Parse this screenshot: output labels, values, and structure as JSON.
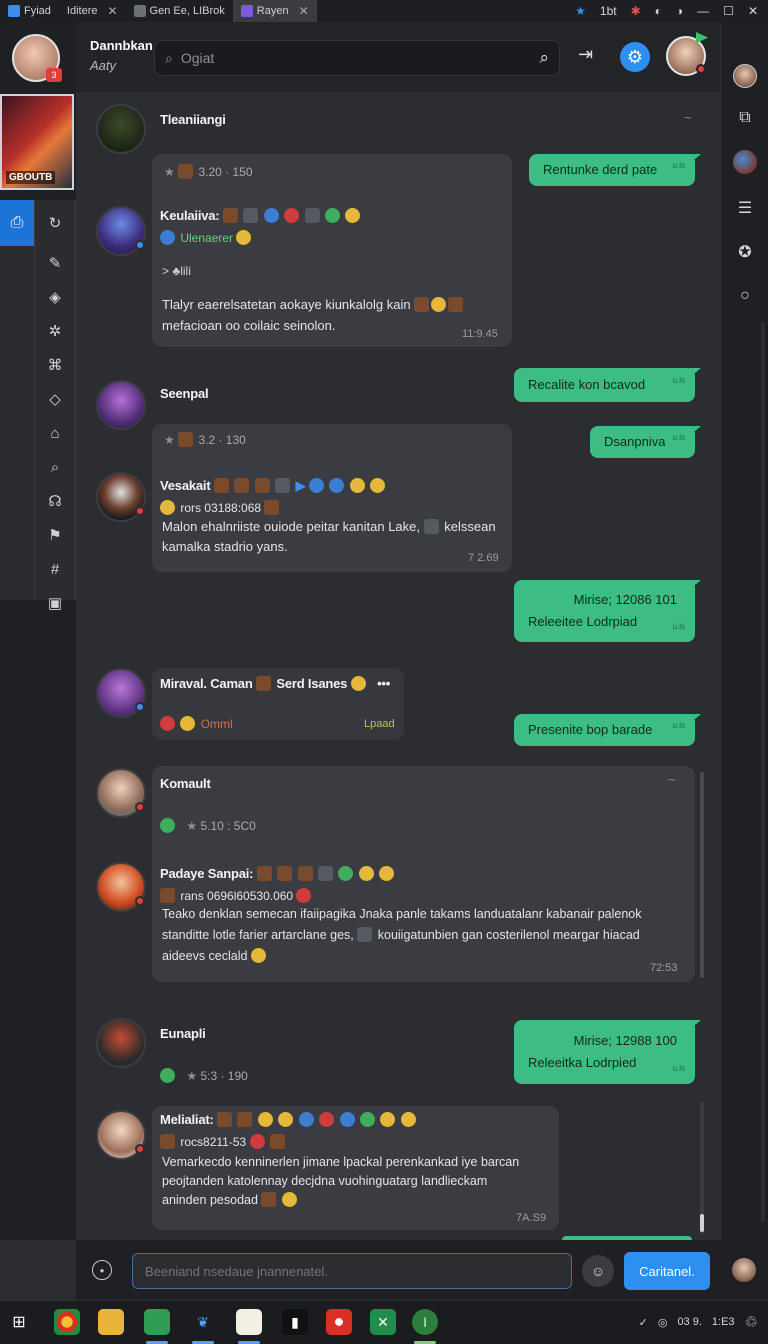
{
  "titlebar": {
    "tabs": [
      {
        "label": "Fyiad"
      },
      {
        "label": "Iditere"
      },
      {
        "label": "Gen Ee, LIBrok"
      },
      {
        "label": "Rayen"
      }
    ],
    "right_label": "1bt"
  },
  "user": {
    "badge": "3"
  },
  "guild": {
    "label": "GBOUTB"
  },
  "header": {
    "name": "Dannbkan",
    "status": "Aaty",
    "search_placeholder": "Ogiat"
  },
  "messages": {
    "m1": {
      "name": "Tleaniiangi",
      "meta": "3.20 · 150"
    },
    "m2": {
      "name": "Keulaiiva:",
      "sub": "Ulenaerer",
      "line": "> ♣lili",
      "text": "Tlalyr eaerelsatetan aokaye kiunkalolg kain",
      "text2": "mefacioan oo coilaic seinolon.",
      "time": "11:9.45"
    },
    "m3": {
      "name": "Seenpal",
      "meta": "3.2 · 130"
    },
    "m4": {
      "name": "Vesakait",
      "id": "rors 03188:068",
      "text": "Malon ehalnriiste ouiode peitar kanitan Lake,",
      "text_end": "kelssean",
      "text2": "kamalka stadrio yans.",
      "time": "7 2.69"
    },
    "m5": {
      "name": "Miraval. Caman",
      "name2": "Serd Isanes",
      "left": "Omml",
      "right": "Lpaad"
    },
    "m6": {
      "name": "Komault",
      "meta": "5.10 : 5C0"
    },
    "m7": {
      "name": "Padaye Sanpai:",
      "id": "rans 0696l60530.060",
      "text": "Teako denklan semecan ifaiipagika Jnaka panle takams landuatalanr kabanair palenok",
      "text2": "standitte lotle farier artarclane ges,",
      "text2b": "kouiigatunbien gan costerilenol meargar hiacad",
      "text3": "aideevs ceclald",
      "time": "72:53"
    },
    "m8": {
      "name": "Eunapli",
      "meta": "5:3 · 190"
    },
    "m9": {
      "name": "Melialiat:",
      "id": "rocs8211-53",
      "text": "Vemarkecdo kenninerlen jimane lpackal perenkankad iye barcan",
      "text2": "peojtanden katolennay decjdna vuohinguatarg landlieckam",
      "text3": "aninden pesodad",
      "time": "7A.S9"
    }
  },
  "bubbles": {
    "b1": "Rentunke derd pate",
    "b2": "Recalite kon bcavod",
    "b3": "Dsanpniva",
    "b4a": "Mirise; 12086 101",
    "b4b": "Releeitee Lodrpiad",
    "b5": "Presenite bop barade",
    "b6a": "Mirise; 12988 100",
    "b6b": "Releeitka Lodrpied",
    "tick": "u.ls"
  },
  "composer": {
    "placeholder": "Beeniand nsedaue jnannenatel.",
    "send_label": "Caritanel."
  },
  "tray": {
    "clock": "03 9.",
    "date": "1:E3"
  },
  "colors": {
    "accent": "#2d8ff0",
    "bubble": "#3dbd84",
    "bg": "#2b2d31",
    "badge": "#e23c3c"
  }
}
